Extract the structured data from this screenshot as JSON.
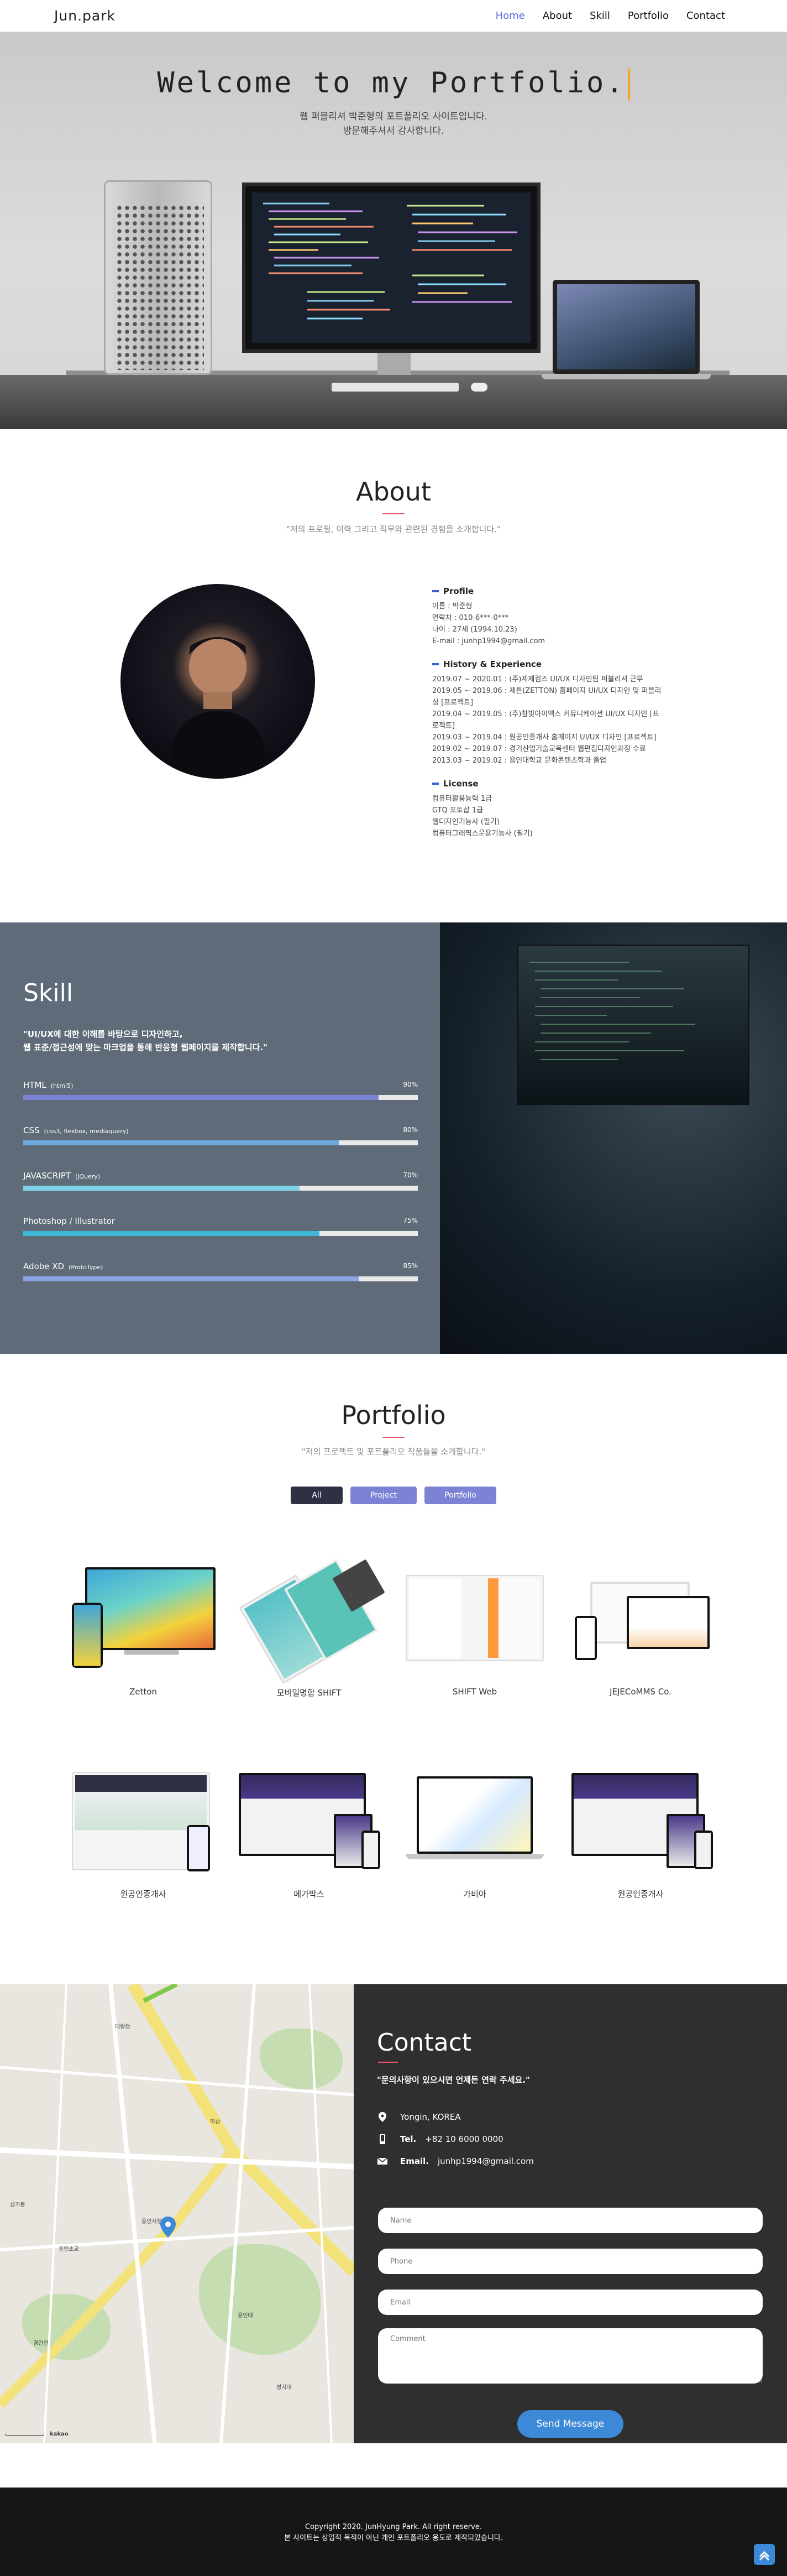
{
  "nav": {
    "logo": "Jun.park",
    "items": [
      "Home",
      "About",
      "Skill",
      "Portfolio",
      "Contact"
    ]
  },
  "hero": {
    "title": "Welcome to my Portfolio.",
    "line1": "웹 퍼블리셔 박준형의 포트폴리오 사이트입니다.",
    "line2": "방문해주셔서 감사합니다."
  },
  "about": {
    "title": "About",
    "subtitle": "\"저의 프로필, 이력 그리고 직무와 관련된 경험을 소개합니다.\"",
    "profile_heading": "Profile",
    "profile": [
      "이름 : 박준형",
      "연락처 : 010-6***-0***",
      "나이 : 27세 (1994.10.23)",
      "E-mail : junhp1994@gmail.com"
    ],
    "history_heading": "History & Experience",
    "history": [
      "2019.07 ~ 2020.01 : (주)제제컴즈 UI/UX 디자인팀 퍼블리셔 근무",
      "2019.05 ~ 2019.06 : 제튼(ZETTON) 홈페이지 UI/UX 디자인 및 퍼블리싱 [프로젝트]",
      "2019.04 ~ 2019.05 : (주)참빛아이엑스 커뮤니케이션 UI/UX 디자인 [프로젝트]",
      "2019.03 ~ 2019.04 : 원공인증개사 홈페이지 UI/UX 디자인 [프로젝트]",
      "2019.02 ~ 2019.07 : 경기산업기술교육센터 웹편집디자인과정 수료",
      "2013.03 ~ 2019.02 : 용인대학교 문화콘텐츠학과 졸업"
    ],
    "license_heading": "License",
    "license": [
      "컴퓨터활용능력 1급",
      "GTQ 포토샵 1급",
      "웹디자인기능사 (필기)",
      "컴퓨터그래픽스운용기능사 (필기)"
    ]
  },
  "skill": {
    "title": "Skill",
    "desc1": "\"UI/UX에 대한 이해를 바탕으로 디자인하고,",
    "desc2": "웹 표준/접근성에 맞는 마크업을 통해 반응형 웹페이지를 제작합니다.\"",
    "items": [
      {
        "name": "HTML",
        "note": "(html5)",
        "percent_label": "90%",
        "percent": 90,
        "color": "#7d83d4"
      },
      {
        "name": "CSS",
        "note": "(css3, flexbox, mediaquery)",
        "percent_label": "80%",
        "percent": 80,
        "color": "#6fa8dc"
      },
      {
        "name": "JAVASCRIPT",
        "note": "(jQuery)",
        "percent_label": "70%",
        "percent": 70,
        "color": "#7fd3e8"
      },
      {
        "name": "Photoshop / Illustrator",
        "note": "",
        "percent_label": "75%",
        "percent": 75,
        "color": "#3fb8d8"
      },
      {
        "name": "Adobe XD",
        "note": "(ProtoType)",
        "percent_label": "85%",
        "percent": 85,
        "color": "#8ba3e0"
      }
    ]
  },
  "portfolio": {
    "title": "Portfolio",
    "subtitle": "\"저의 프로젝트 및 포트폴리오 작품들을 소개합니다.\"",
    "filters": [
      "All",
      "Project",
      "Portfolio"
    ],
    "works": [
      "Zetton",
      "모바일명함 SHIFT",
      "SHIFT Web",
      "JEJECoMMS Co.",
      "원공인중개사",
      "메가박스",
      "가비아",
      "원공인중개사"
    ]
  },
  "map": {
    "labels": [
      "대왕청",
      "삼가동",
      "역삼",
      "용인시청",
      "용인초교",
      "명지대",
      "용인대",
      "경안천"
    ],
    "scale": "kakao"
  },
  "contact": {
    "title": "Contact",
    "subtitle": "\"문의사항이 있으시면 언제든 연락 주세요.\"",
    "location": "Yongin, KOREA",
    "tel_label": "Tel.",
    "tel": "+82 10 6000 0000",
    "email_label": "Email.",
    "email": "junhp1994@gmail.com",
    "placeholders": {
      "name": "Name",
      "phone": "Phone",
      "email": "Email",
      "comment": "Comment"
    },
    "send": "Send Message"
  },
  "footer": {
    "copyright": "Copyright 2020. JunHyung Park. All right reserve.",
    "note": "본 사이트는 상업적 목적이 아닌 개인 포트폴리오 용도로 제작되었습니다."
  },
  "colors": {
    "accent": "#5b6de0",
    "filter_all": "#2e3142",
    "filter_other": "#7d83d4",
    "send": "#3c89d8"
  }
}
